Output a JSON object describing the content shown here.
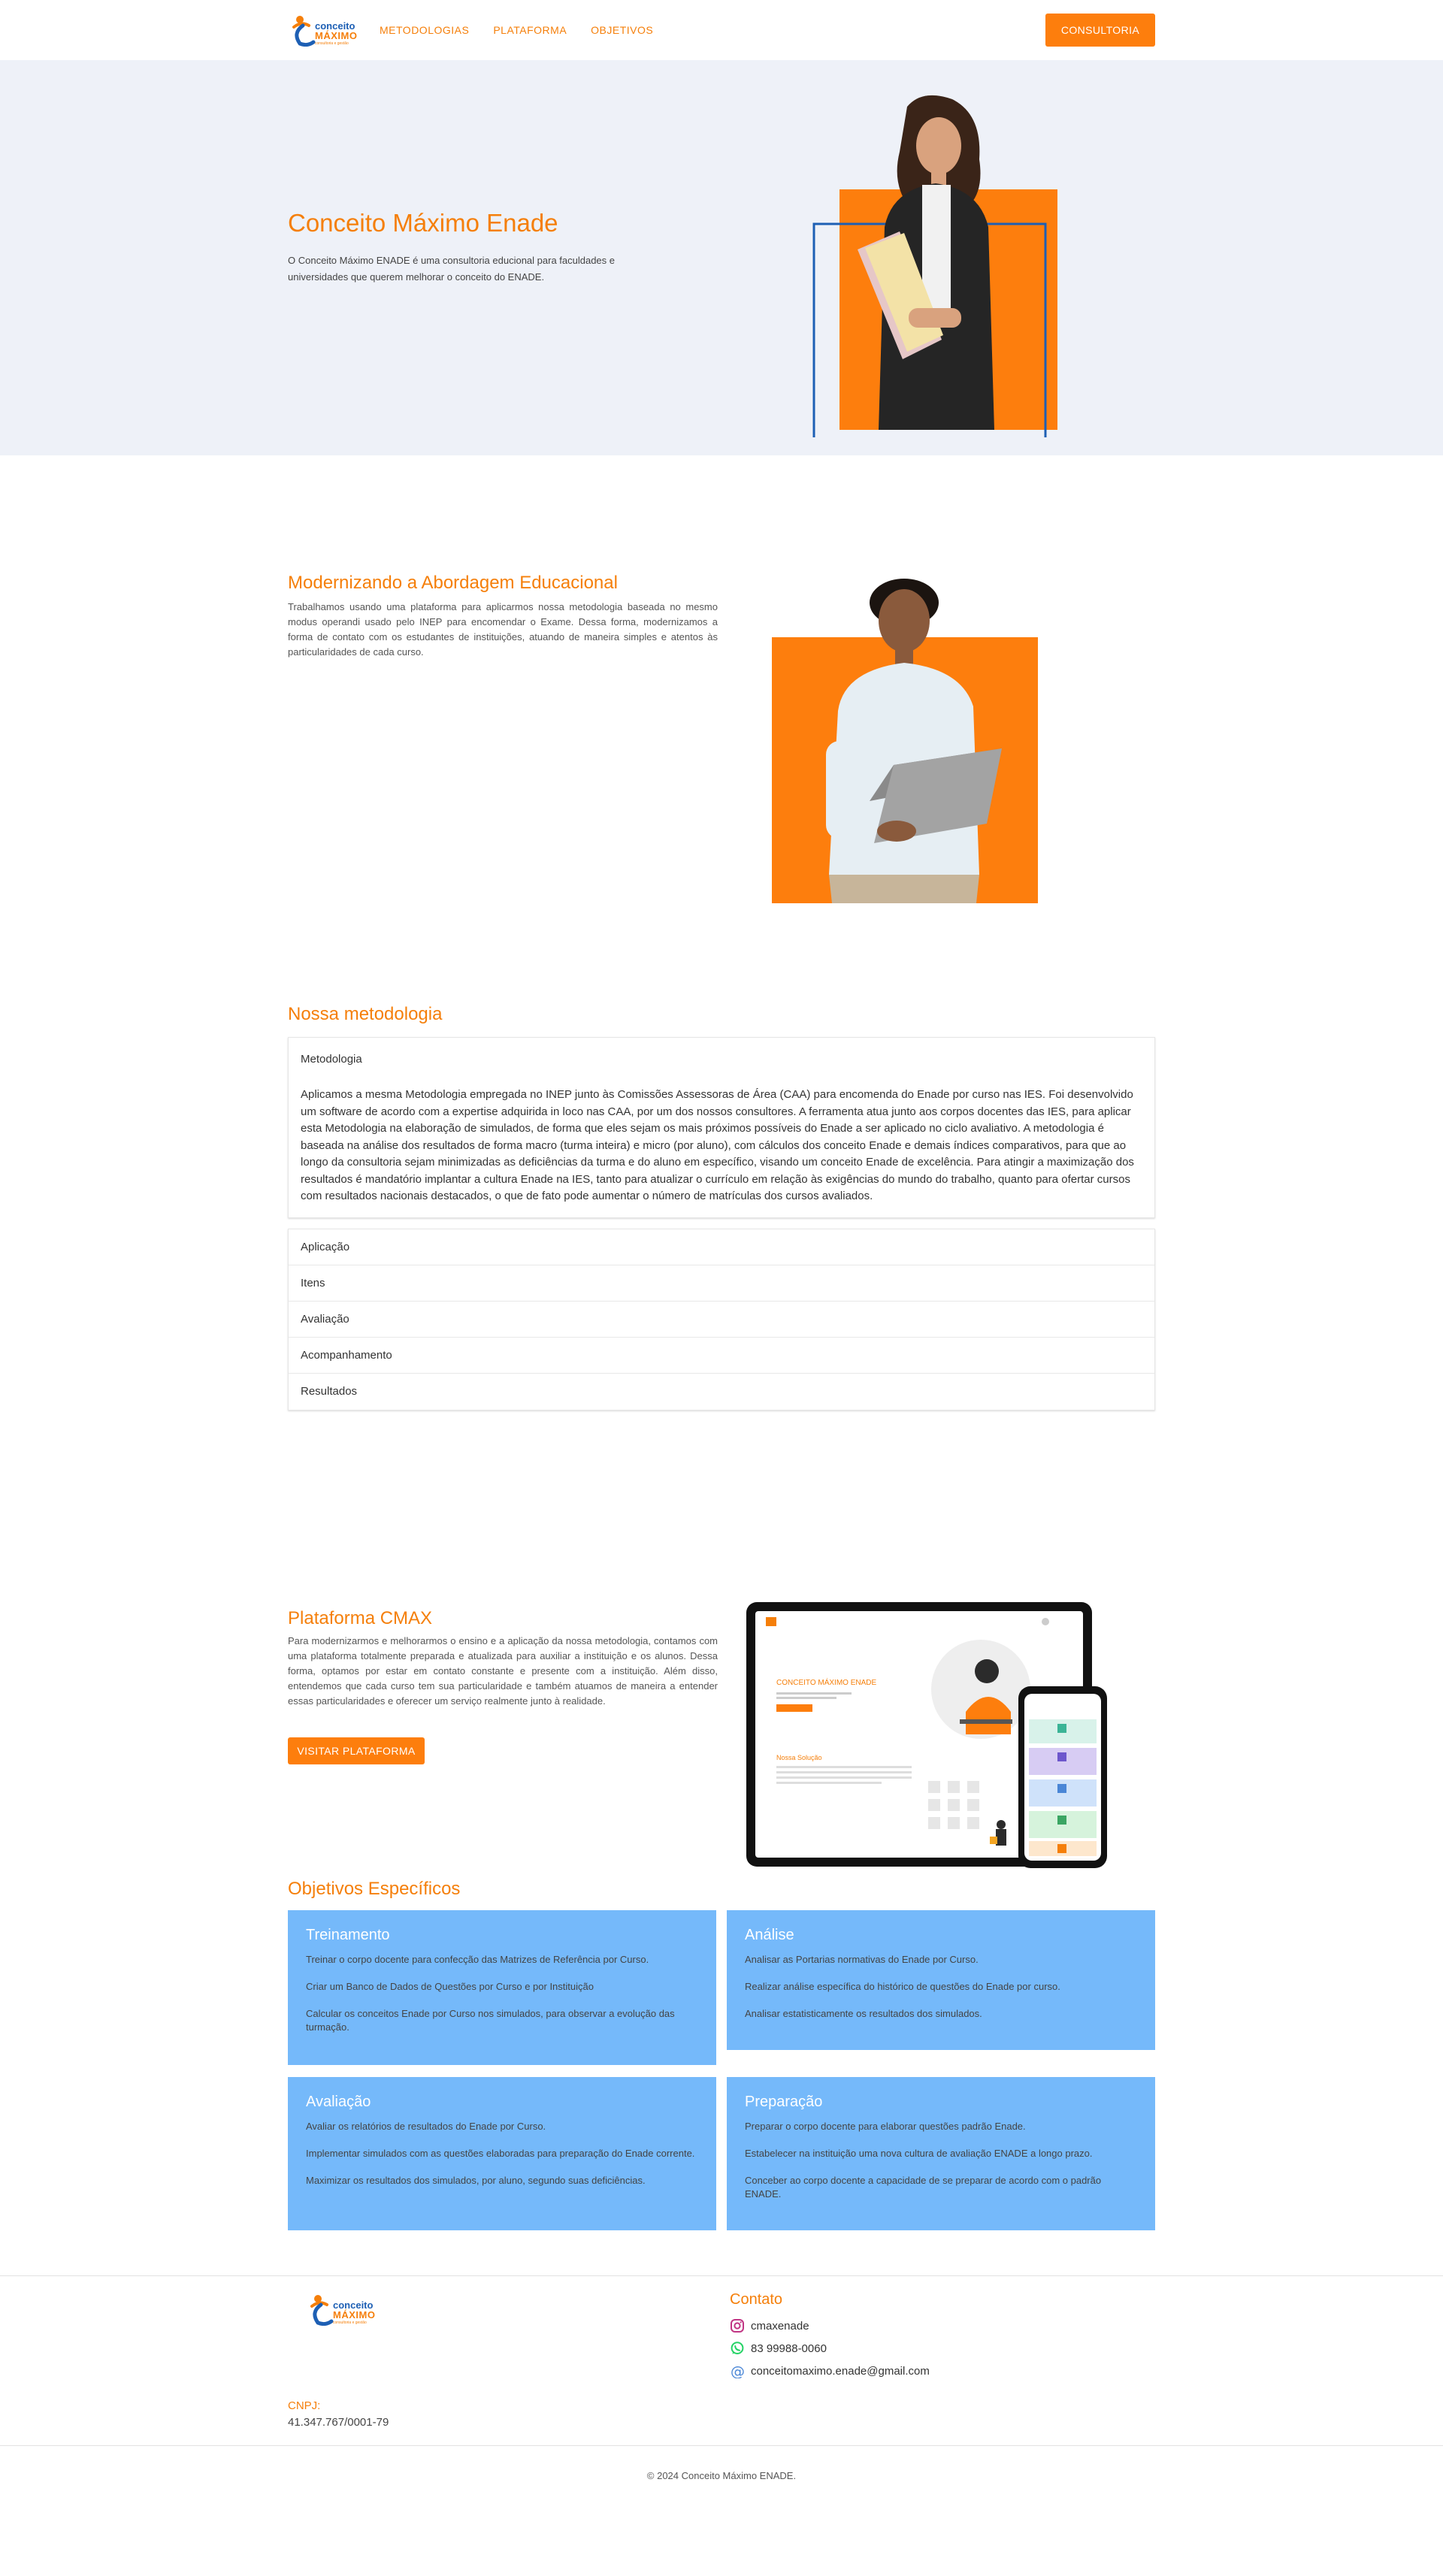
{
  "nav": {
    "logo": {
      "line1": "conceito",
      "line2": "MÁXIMO",
      "line3": "consultoria e gestão"
    },
    "links": [
      "METODOLOGIAS",
      "PLATAFORMA",
      "OBJETIVOS"
    ],
    "cta": "CONSULTORIA"
  },
  "hero": {
    "title": "Conceito Máximo Enade",
    "text": "O Conceito Máximo ENADE é uma consultoria educional para faculdades e universidades que querem melhorar o conceito do ENADE."
  },
  "approach": {
    "title": "Modernizando a Abordagem Educacional",
    "text": "Trabalhamos usando uma plataforma para aplicarmos nossa metodologia baseada no mesmo modus operandi usado pelo INEP para encomendar o Exame. Dessa forma, modernizamos a forma de contato com os estudantes de instituições, atuando de maneira simples e atentos às particularidades de cada curso."
  },
  "methodology": {
    "title": "Nossa metodologia",
    "open_item": {
      "title": "Metodologia",
      "body": "Aplicamos a mesma Metodologia empregada no INEP junto às Comissões Assessoras de Área (CAA) para encomenda do Enade por curso nas IES. Foi desenvolvido um software de acordo com a expertise adquirida in loco nas CAA, por um dos nossos consultores. A ferramenta atua junto aos corpos docentes das IES, para aplicar esta Metodologia na elaboração de simulados, de forma que eles sejam os mais próximos possíveis do Enade a ser aplicado no ciclo avaliativo. A metodologia é baseada na análise dos resultados de forma macro (turma inteira) e micro (por aluno), com cálculos dos conceito Enade e demais índices comparativos, para que ao longo da consultoria sejam minimizadas as deficiências da turma e do aluno em específico, visando um conceito Enade de excelência. Para atingir a maximização dos resultados é mandatório implantar a cultura Enade na IES, tanto para atualizar o currículo em relação às exigências do mundo do trabalho, quanto para ofertar cursos com resultados nacionais destacados, o que de fato pode aumentar o número de matrículas dos cursos avaliados."
    },
    "items": [
      "Aplicação",
      "Itens",
      "Avaliação",
      "Acompanhamento",
      "Resultados"
    ]
  },
  "platform": {
    "title": "Plataforma CMAX",
    "text": "Para modernizarmos e melhorarmos o ensino e a aplicação da nossa metodologia, contamos com uma plataforma totalmente preparada e atualizada para auxiliar a instituição e os alunos. Dessa forma, optamos por estar em contato constante e presente com a instituição. Além disso, entendemos que cada curso tem sua particularidade e também atuamos de maneira a entender essas particularidades e oferecer um serviço realmente junto à realidade.",
    "cta": "VISITAR PLATAFORMA",
    "mock": {
      "tablet_title": "CONCEITO MÁXIMO ENADE",
      "tablet_section": "Nossa Solução"
    }
  },
  "objectives": {
    "title": "Objetivos Específicos",
    "cards": [
      {
        "title": "Treinamento",
        "items": [
          "Treinar o corpo docente para confecção das Matrizes de Referência por Curso.",
          "Criar um Banco de Dados de Questões por Curso e por Instituição",
          "Calcular os conceitos Enade por Curso nos simulados, para observar a evolução das turmação."
        ]
      },
      {
        "title": "Análise",
        "items": [
          "Analisar as Portarias normativas do Enade por Curso.",
          "Realizar análise específica do histórico de questões do Enade por curso.",
          "Analisar estatisticamente os resultados dos simulados."
        ]
      },
      {
        "title": "Avaliação",
        "items": [
          "Avaliar os relatórios de resultados do Enade por Curso.",
          "Implementar simulados com as questões elaboradas para preparação do Enade corrente.",
          "Maximizar os resultados dos simulados, por aluno, segundo suas deficiências."
        ]
      },
      {
        "title": "Preparação",
        "items": [
          "Preparar o corpo docente para elaborar questões padrão Enade.",
          "Estabelecer na instituição uma nova cultura de avaliação ENADE a longo prazo.",
          "Conceber ao corpo docente a capacidade de se preparar de acordo com o padrão ENADE."
        ]
      }
    ]
  },
  "footer": {
    "logo": {
      "line1": "conceito",
      "line2": "MÁXIMO",
      "line3": "consultoria e gestão"
    },
    "cnpj_label": "CNPJ:",
    "cnpj": "41.347.767/0001-79",
    "contact_title": "Contato",
    "instagram": "cmaxenade",
    "whatsapp": "83 99988-0060",
    "email": "conceitomaximo.enade@gmail.com",
    "copyright": "© 2024 Conceito Máximo ENADE."
  },
  "colors": {
    "accent": "#f57f0a",
    "button": "#fd7e0d",
    "card": "#75b9fa",
    "navy": "#1d5fb4",
    "hero_bg": "#eef1f8"
  }
}
